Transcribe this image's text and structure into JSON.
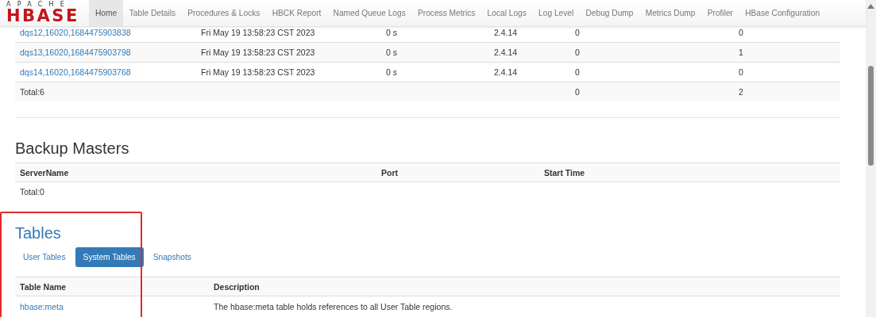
{
  "navbar": {
    "logo": {
      "top": "APACHE",
      "main": "HBASE"
    },
    "items": [
      {
        "label": "Home",
        "selected": true
      },
      {
        "label": "Table Details",
        "selected": false
      },
      {
        "label": "Procedures & Locks",
        "selected": false
      },
      {
        "label": "HBCK Report",
        "selected": false
      },
      {
        "label": "Named Queue Logs",
        "selected": false
      },
      {
        "label": "Process Metrics",
        "selected": false
      },
      {
        "label": "Local Logs",
        "selected": false
      },
      {
        "label": "Log Level",
        "selected": false
      },
      {
        "label": "Debug Dump",
        "selected": false
      },
      {
        "label": "Metrics Dump",
        "selected": false
      },
      {
        "label": "Profiler",
        "selected": false
      },
      {
        "label": "HBase Configuration",
        "selected": false
      }
    ]
  },
  "region_servers": {
    "rows": [
      {
        "column_1": "dqs12,16020,1684475903838",
        "column_2": "Fri May 19 13:58:23 CST 2023",
        "column_3": "0 s",
        "column_4": "2.4.14",
        "column_5": "0",
        "column_6": "0"
      },
      {
        "column_1": "dqs13,16020,1684475903798",
        "column_2": "Fri May 19 13:58:23 CST 2023",
        "column_3": "0 s",
        "column_4": "2.4.14",
        "column_5": "0",
        "column_6": "1"
      },
      {
        "column_1": "dqs14,16020,1684475903768",
        "column_2": "Fri May 19 13:58:23 CST 2023",
        "column_3": "0 s",
        "column_4": "2.4.14",
        "column_5": "0",
        "column_6": "0"
      }
    ],
    "total": {
      "column_1": "Total:6",
      "column_5": "0",
      "column_6": "2"
    }
  },
  "backup_masters": {
    "title": "Backup Masters",
    "columns": [
      "ServerName",
      "Port",
      "Start Time"
    ],
    "total": "Total:0"
  },
  "tables": {
    "title": "Tables",
    "highlighted": true,
    "tabs": [
      {
        "label": "User Tables",
        "selected": false
      },
      {
        "label": "System Tables",
        "selected": true
      },
      {
        "label": "Snapshots",
        "selected": false
      }
    ],
    "columns": [
      "Table Name",
      "Description"
    ],
    "rows": [
      {
        "name": "hbase:meta",
        "description": "The hbase:meta table holds references to all User Table regions."
      }
    ]
  }
}
